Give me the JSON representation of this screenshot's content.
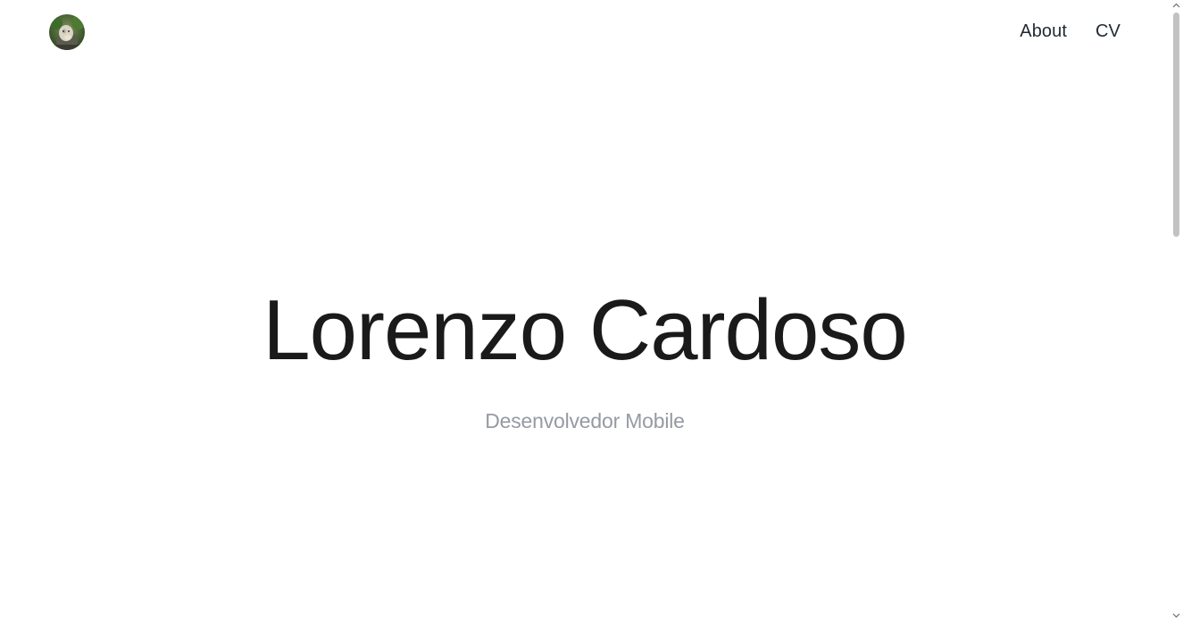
{
  "header": {
    "avatar_alt": "profile photo",
    "nav": [
      {
        "label": "About"
      },
      {
        "label": "CV"
      }
    ]
  },
  "hero": {
    "name": "Lorenzo Cardoso",
    "subtitle": "Desenvolvedor Mobile"
  },
  "colors": {
    "background": "#ffffff",
    "heading": "#1a1a1a",
    "nav_text": "#1f2933",
    "subtitle": "#959aa3",
    "scrollbar_thumb": "#c2c2c2"
  },
  "icons": {
    "scroll_up": "chevron-up-icon",
    "scroll_down": "chevron-down-icon"
  }
}
